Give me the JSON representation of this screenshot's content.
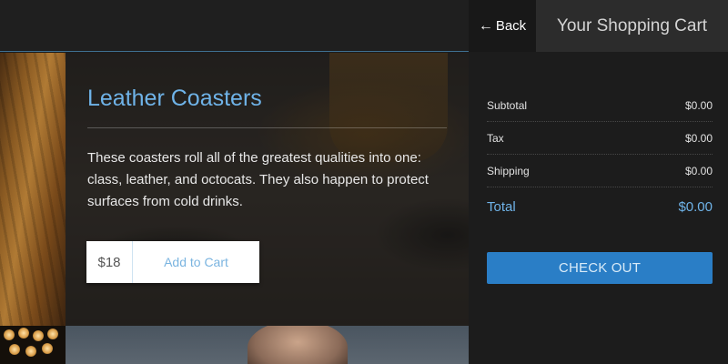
{
  "header": {
    "back_label": "Back",
    "cart_title": "Your Shopping Cart"
  },
  "product": {
    "title": "Leather Coasters",
    "description": "These coasters roll all of the greatest qualities into one: class, leather, and octocats. They also happen to protect surfaces from cold drinks.",
    "price": "$18",
    "add_to_cart_label": "Add to Cart"
  },
  "cart": {
    "subtotal_label": "Subtotal",
    "subtotal_value": "$0.00",
    "tax_label": "Tax",
    "tax_value": "$0.00",
    "shipping_label": "Shipping",
    "shipping_value": "$0.00",
    "total_label": "Total",
    "total_value": "$0.00",
    "checkout_label": "CHECK OUT"
  },
  "colors": {
    "accent": "#6fb3e8",
    "checkout_button": "#2a7ec6",
    "background": "#1c1c1c"
  },
  "icons": {
    "back": "left-arrow-icon"
  }
}
